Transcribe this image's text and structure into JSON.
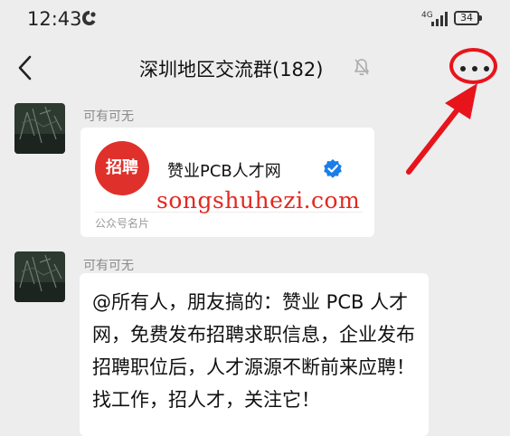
{
  "status_bar": {
    "time": "12:43",
    "network_label": "4G",
    "battery_level": "34"
  },
  "nav": {
    "title": "深圳地区交流群(182)"
  },
  "messages": [
    {
      "sender": "可有可无",
      "type": "card",
      "card": {
        "logo_text": "招聘",
        "name": "赞业PCB人才网",
        "type_label": "公众号名片"
      }
    },
    {
      "sender": "可有可无",
      "type": "text",
      "text": "@所有人，朋友搞的：赞业 PCB 人才网，免费发布招聘求职信息，企业发布招聘职位后，人才源源不断前来应聘！找工作，招人才，关注它！"
    }
  ],
  "overlay": {
    "watermark": "songshuhezi.com",
    "annotation_color": "#e8141c"
  },
  "colors": {
    "background": "#ededed",
    "bubble": "#ffffff",
    "logo": "#e0302b",
    "verified": "#1a7ee8"
  }
}
